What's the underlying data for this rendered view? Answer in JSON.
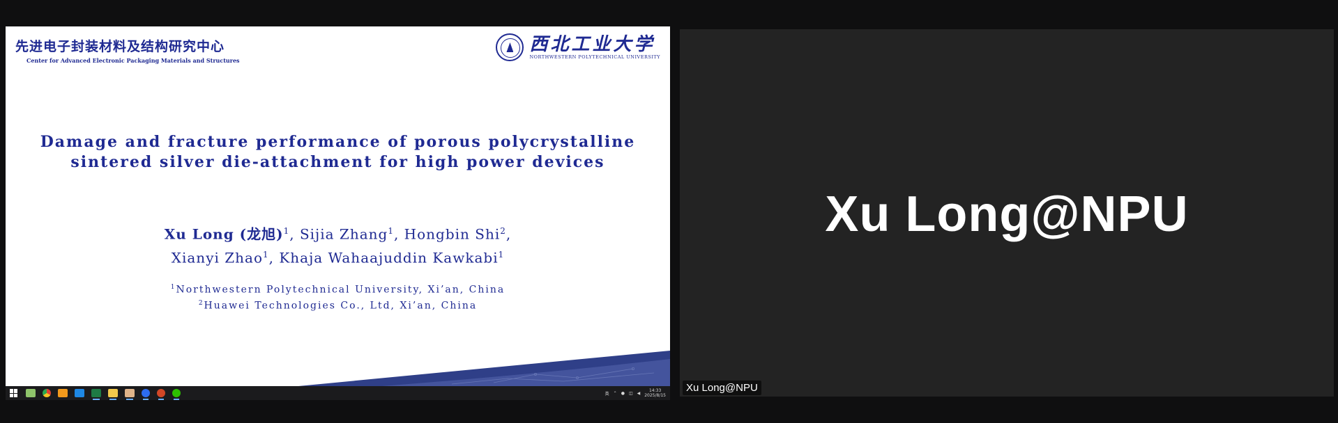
{
  "slide": {
    "header_cn": "先进电子封装材料及结构研究中心",
    "header_en": "Center for Advanced Electronic Packaging Materials and Structures",
    "university_cn": "西北工业大学",
    "university_en": "NORTHWESTERN POLYTECHNICAL UNIVERSITY",
    "title_line1": "Damage and fracture performance of porous polycrystalline",
    "title_line2": "sintered silver die-attachment for high power devices",
    "authors": {
      "lead": "Xu Long (龙旭)",
      "sup1": "1",
      "a2": ", Sijia Zhang",
      "sup2": "1",
      "a3": ", Hongbin Shi",
      "sup3": "2",
      "a3_tail": ",",
      "a4": "Xianyi Zhao",
      "sup4": "1",
      "a5": ", Khaja Wahaajuddin Kawkabi",
      "sup5": "1"
    },
    "affiliations": [
      {
        "sup": "1",
        "text": "Northwestern Polytechnical University, Xi’an, China"
      },
      {
        "sup": "2",
        "text": "Huawei Technologies Co., Ltd, Xi’an, China"
      }
    ],
    "accent_color": "#1f2a92"
  },
  "taskbar": {
    "icons": [
      "windows-start-icon",
      "notepad-icon",
      "chrome-icon",
      "search-app-icon",
      "star-app-icon",
      "excel-icon",
      "file-explorer-icon",
      "mail-icon",
      "zoom-icon",
      "powerpoint-icon",
      "wechat-icon"
    ],
    "tray_lang": "英",
    "time": "14:33",
    "date": "2025/8/15"
  },
  "video": {
    "display_name": "Xu Long@NPU",
    "name_label": "Xu Long@NPU",
    "background": "#232323"
  }
}
